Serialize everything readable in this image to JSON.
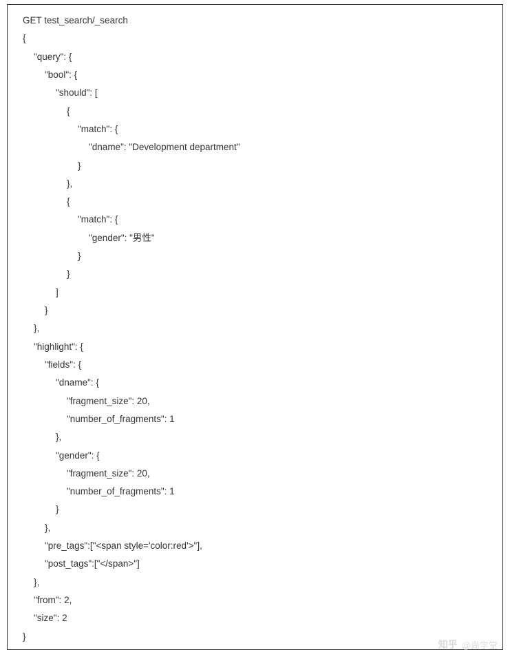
{
  "code": {
    "lines": [
      {
        "indent": 0,
        "text": "GET test_search/_search"
      },
      {
        "indent": 0,
        "text": "{"
      },
      {
        "indent": 1,
        "text": "\"query\": {"
      },
      {
        "indent": 2,
        "text": "\"bool\": {"
      },
      {
        "indent": 3,
        "text": "\"should\": ["
      },
      {
        "indent": 4,
        "text": "{"
      },
      {
        "indent": 5,
        "text": "\"match\": {"
      },
      {
        "indent": 6,
        "text": "\"dname\": \"Development department\""
      },
      {
        "indent": 5,
        "text": "}"
      },
      {
        "indent": 4,
        "text": "},"
      },
      {
        "indent": 4,
        "text": "{"
      },
      {
        "indent": 5,
        "text": "\"match\": {"
      },
      {
        "indent": 6,
        "text": "\"gender\": \"男性\""
      },
      {
        "indent": 5,
        "text": "}"
      },
      {
        "indent": 4,
        "text": "}"
      },
      {
        "indent": 3,
        "text": "]"
      },
      {
        "indent": 2,
        "text": "}"
      },
      {
        "indent": 1,
        "text": "},"
      },
      {
        "indent": 1,
        "text": "\"highlight\": {"
      },
      {
        "indent": 2,
        "text": "\"fields\": {"
      },
      {
        "indent": 3,
        "text": "\"dname\": {"
      },
      {
        "indent": 4,
        "text": "\"fragment_size\": 20,"
      },
      {
        "indent": 4,
        "text": "\"number_of_fragments\": 1"
      },
      {
        "indent": 3,
        "text": "},"
      },
      {
        "indent": 3,
        "text": "\"gender\": {"
      },
      {
        "indent": 4,
        "text": "\"fragment_size\": 20,"
      },
      {
        "indent": 4,
        "text": "\"number_of_fragments\": 1"
      },
      {
        "indent": 3,
        "text": "}"
      },
      {
        "indent": 2,
        "text": "},"
      },
      {
        "indent": 2,
        "text": "\"pre_tags\":[\"<span style='color:red'>\"],"
      },
      {
        "indent": 2,
        "text": "\"post_tags\":[\"</span>\"]"
      },
      {
        "indent": 1,
        "text": "},"
      },
      {
        "indent": 1,
        "text": "\"from\": 2,"
      },
      {
        "indent": 1,
        "text": "\"size\": 2"
      },
      {
        "indent": 0,
        "text": "}"
      }
    ]
  },
  "watermark": {
    "brand": "知乎",
    "handle": "@尚学堂"
  }
}
